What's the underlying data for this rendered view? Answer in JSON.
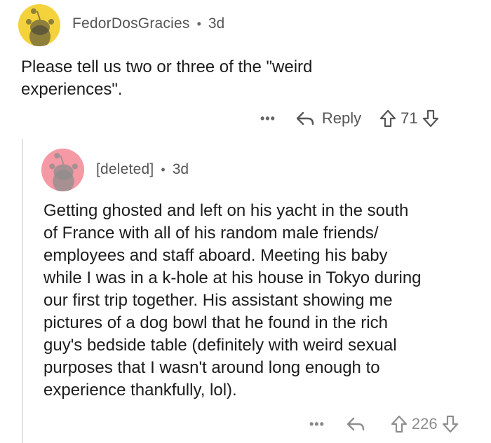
{
  "parent_comment": {
    "author": "FedorDosGracies",
    "separator": "•",
    "age": "3d",
    "text_lines": [
      "Please tell us two or three of the \"weird",
      "experiences\"."
    ],
    "actions": {
      "more_label": "•••",
      "reply_label": "Reply",
      "score": "71"
    },
    "avatar_color": "#F4D23C"
  },
  "reply_comment": {
    "author": "[deleted]",
    "separator": "•",
    "age": "3d",
    "text_lines": [
      "Getting ghosted and left on his yacht in the south",
      "of France with all of his random male friends/",
      "employees and staff aboard. Meeting his baby",
      "while I was in a k-hole at his house in Tokyo during",
      "our first trip together. His assistant showing me",
      "pictures of a dog bowl that he found in the rich",
      "guy's bedside table (definitely with weird sexual",
      "purposes that I wasn't around long enough to",
      "experience thankfully, lol)."
    ],
    "actions": {
      "more_label": "•••",
      "score": "226"
    },
    "avatar_color": "#F59AA5"
  }
}
